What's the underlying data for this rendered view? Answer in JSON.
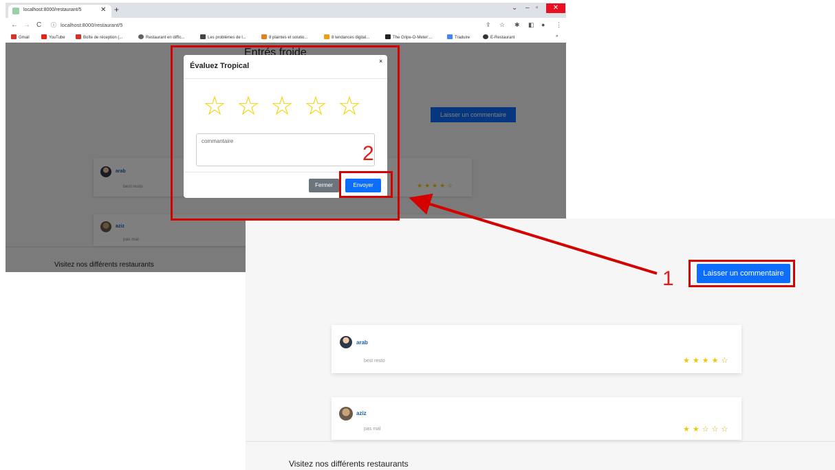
{
  "browser": {
    "tab_title": "localhost:8000/restaurant/5",
    "url": "localhost:8000/restaurant/5",
    "bookmarks": [
      {
        "label": "Gmail",
        "icon": "gmail-icon",
        "color": "#d93025"
      },
      {
        "label": "YouTube",
        "icon": "youtube-icon",
        "color": "#e62117"
      },
      {
        "label": "Boîte de réception (...",
        "icon": "gmail-icon",
        "color": "#d93025"
      },
      {
        "label": "Restaurant en diffic...",
        "icon": "globe-icon",
        "color": "#5f6368"
      },
      {
        "label": "Les problèmes de l...",
        "icon": "site-icon",
        "color": "#444444"
      },
      {
        "label": "8 plaintes et solutio...",
        "icon": "site-icon",
        "color": "#e67e22"
      },
      {
        "label": "8 tendances digital...",
        "icon": "site-icon",
        "color": "#f39c12"
      },
      {
        "label": "The Gripe-O-Meter:...",
        "icon": "site-icon",
        "color": "#222222"
      },
      {
        "label": "Traduire",
        "icon": "translate-icon",
        "color": "#4285f4"
      },
      {
        "label": "E-Restaurant",
        "icon": "globe-icon",
        "color": "#333333"
      }
    ],
    "bookmarks_more": "»"
  },
  "page1": {
    "heading": "Entrés froide",
    "comment_button": "Laisser un commentaire",
    "footer": "Visitez nos différents restaurants"
  },
  "modal": {
    "title": "Évaluez Tropical",
    "close": "×",
    "rating_stars": 5,
    "textarea_placeholder": "commantaire",
    "cancel_button": "Fermer",
    "submit_button": "Envoyer"
  },
  "reviews": [
    {
      "user": "arab",
      "comment": "best resto",
      "rating": 4,
      "max": 5
    },
    {
      "user": "aziz",
      "comment": "pas mal",
      "rating": 2,
      "max": 5
    }
  ],
  "page2": {
    "comment_button": "Laisser un commentaire",
    "footer": "Visitez nos différents restaurants"
  },
  "annotations": {
    "step1": "1",
    "step2": "2",
    "color": "#d50000"
  }
}
